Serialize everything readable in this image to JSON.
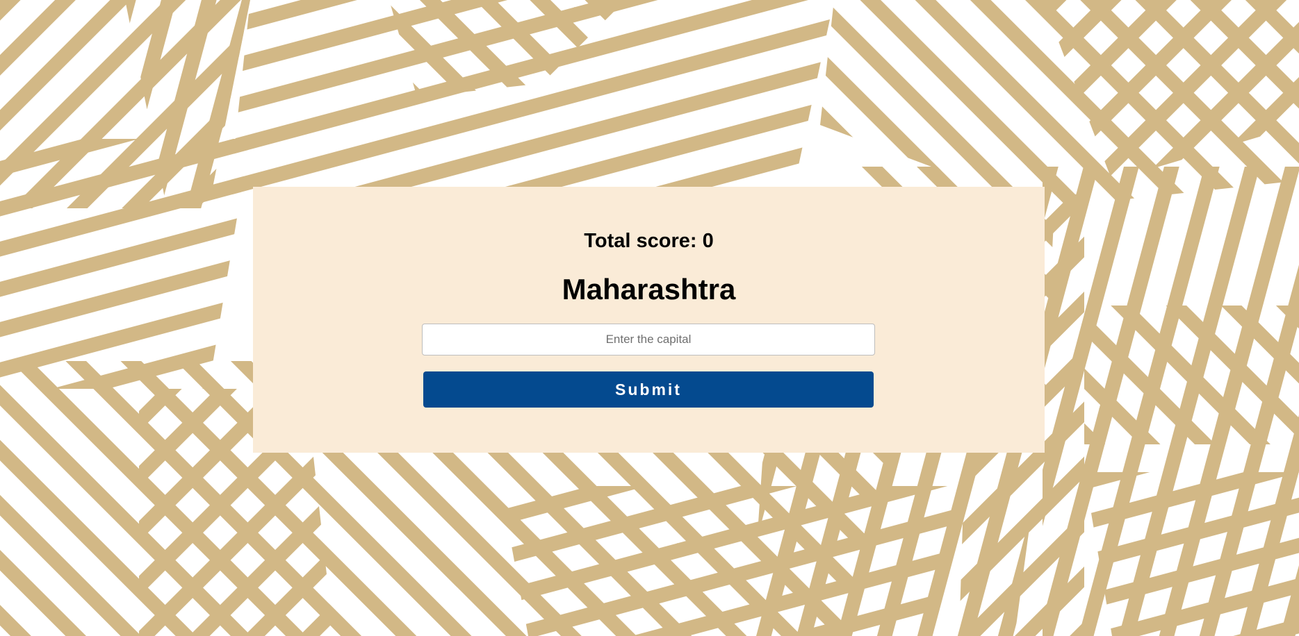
{
  "quiz": {
    "score_text": "Total score: 0",
    "state_name": "Maharashtra",
    "input_placeholder": "Enter the capital",
    "submit_label": "Submit"
  },
  "colors": {
    "background_pattern": "#d2b886",
    "background_base": "#ffffff",
    "card_background": "#faebd7",
    "submit_button": "#044a8f"
  }
}
